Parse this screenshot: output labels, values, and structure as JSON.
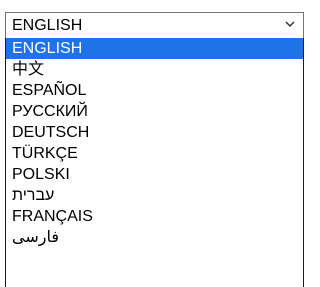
{
  "select": {
    "value": "ENGLISH",
    "chevron_icon": "chevron-down-icon"
  },
  "colors": {
    "highlight": "#1e73e8",
    "border": "#767676"
  },
  "options": [
    {
      "label": "ENGLISH",
      "selected": true
    },
    {
      "label": "中文",
      "selected": false
    },
    {
      "label": "ESPAÑOL",
      "selected": false
    },
    {
      "label": "РУССКИЙ",
      "selected": false
    },
    {
      "label": "DEUTSCH",
      "selected": false
    },
    {
      "label": "TÜRKÇE",
      "selected": false
    },
    {
      "label": "POLSKI",
      "selected": false
    },
    {
      "label": "עברית",
      "selected": false
    },
    {
      "label": "FRANÇAIS",
      "selected": false
    },
    {
      "label": "فارسی",
      "selected": false
    }
  ]
}
